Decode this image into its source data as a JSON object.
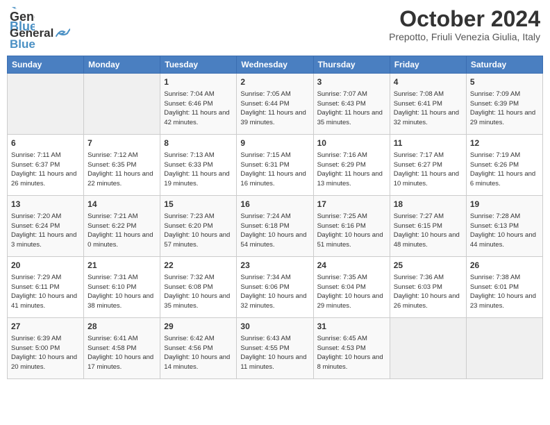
{
  "header": {
    "logo_line1": "General",
    "logo_line2": "Blue",
    "month": "October 2024",
    "location": "Prepotto, Friuli Venezia Giulia, Italy"
  },
  "weekdays": [
    "Sunday",
    "Monday",
    "Tuesday",
    "Wednesday",
    "Thursday",
    "Friday",
    "Saturday"
  ],
  "weeks": [
    [
      {
        "day": "",
        "info": ""
      },
      {
        "day": "",
        "info": ""
      },
      {
        "day": "1",
        "info": "Sunrise: 7:04 AM\nSunset: 6:46 PM\nDaylight: 11 hours and 42 minutes."
      },
      {
        "day": "2",
        "info": "Sunrise: 7:05 AM\nSunset: 6:44 PM\nDaylight: 11 hours and 39 minutes."
      },
      {
        "day": "3",
        "info": "Sunrise: 7:07 AM\nSunset: 6:43 PM\nDaylight: 11 hours and 35 minutes."
      },
      {
        "day": "4",
        "info": "Sunrise: 7:08 AM\nSunset: 6:41 PM\nDaylight: 11 hours and 32 minutes."
      },
      {
        "day": "5",
        "info": "Sunrise: 7:09 AM\nSunset: 6:39 PM\nDaylight: 11 hours and 29 minutes."
      }
    ],
    [
      {
        "day": "6",
        "info": "Sunrise: 7:11 AM\nSunset: 6:37 PM\nDaylight: 11 hours and 26 minutes."
      },
      {
        "day": "7",
        "info": "Sunrise: 7:12 AM\nSunset: 6:35 PM\nDaylight: 11 hours and 22 minutes."
      },
      {
        "day": "8",
        "info": "Sunrise: 7:13 AM\nSunset: 6:33 PM\nDaylight: 11 hours and 19 minutes."
      },
      {
        "day": "9",
        "info": "Sunrise: 7:15 AM\nSunset: 6:31 PM\nDaylight: 11 hours and 16 minutes."
      },
      {
        "day": "10",
        "info": "Sunrise: 7:16 AM\nSunset: 6:29 PM\nDaylight: 11 hours and 13 minutes."
      },
      {
        "day": "11",
        "info": "Sunrise: 7:17 AM\nSunset: 6:27 PM\nDaylight: 11 hours and 10 minutes."
      },
      {
        "day": "12",
        "info": "Sunrise: 7:19 AM\nSunset: 6:26 PM\nDaylight: 11 hours and 6 minutes."
      }
    ],
    [
      {
        "day": "13",
        "info": "Sunrise: 7:20 AM\nSunset: 6:24 PM\nDaylight: 11 hours and 3 minutes."
      },
      {
        "day": "14",
        "info": "Sunrise: 7:21 AM\nSunset: 6:22 PM\nDaylight: 11 hours and 0 minutes."
      },
      {
        "day": "15",
        "info": "Sunrise: 7:23 AM\nSunset: 6:20 PM\nDaylight: 10 hours and 57 minutes."
      },
      {
        "day": "16",
        "info": "Sunrise: 7:24 AM\nSunset: 6:18 PM\nDaylight: 10 hours and 54 minutes."
      },
      {
        "day": "17",
        "info": "Sunrise: 7:25 AM\nSunset: 6:16 PM\nDaylight: 10 hours and 51 minutes."
      },
      {
        "day": "18",
        "info": "Sunrise: 7:27 AM\nSunset: 6:15 PM\nDaylight: 10 hours and 48 minutes."
      },
      {
        "day": "19",
        "info": "Sunrise: 7:28 AM\nSunset: 6:13 PM\nDaylight: 10 hours and 44 minutes."
      }
    ],
    [
      {
        "day": "20",
        "info": "Sunrise: 7:29 AM\nSunset: 6:11 PM\nDaylight: 10 hours and 41 minutes."
      },
      {
        "day": "21",
        "info": "Sunrise: 7:31 AM\nSunset: 6:10 PM\nDaylight: 10 hours and 38 minutes."
      },
      {
        "day": "22",
        "info": "Sunrise: 7:32 AM\nSunset: 6:08 PM\nDaylight: 10 hours and 35 minutes."
      },
      {
        "day": "23",
        "info": "Sunrise: 7:34 AM\nSunset: 6:06 PM\nDaylight: 10 hours and 32 minutes."
      },
      {
        "day": "24",
        "info": "Sunrise: 7:35 AM\nSunset: 6:04 PM\nDaylight: 10 hours and 29 minutes."
      },
      {
        "day": "25",
        "info": "Sunrise: 7:36 AM\nSunset: 6:03 PM\nDaylight: 10 hours and 26 minutes."
      },
      {
        "day": "26",
        "info": "Sunrise: 7:38 AM\nSunset: 6:01 PM\nDaylight: 10 hours and 23 minutes."
      }
    ],
    [
      {
        "day": "27",
        "info": "Sunrise: 6:39 AM\nSunset: 5:00 PM\nDaylight: 10 hours and 20 minutes."
      },
      {
        "day": "28",
        "info": "Sunrise: 6:41 AM\nSunset: 4:58 PM\nDaylight: 10 hours and 17 minutes."
      },
      {
        "day": "29",
        "info": "Sunrise: 6:42 AM\nSunset: 4:56 PM\nDaylight: 10 hours and 14 minutes."
      },
      {
        "day": "30",
        "info": "Sunrise: 6:43 AM\nSunset: 4:55 PM\nDaylight: 10 hours and 11 minutes."
      },
      {
        "day": "31",
        "info": "Sunrise: 6:45 AM\nSunset: 4:53 PM\nDaylight: 10 hours and 8 minutes."
      },
      {
        "day": "",
        "info": ""
      },
      {
        "day": "",
        "info": ""
      }
    ]
  ]
}
